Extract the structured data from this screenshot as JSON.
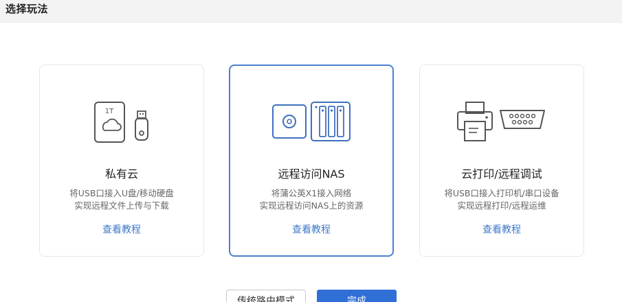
{
  "header": {
    "title": "选择玩法"
  },
  "cards": [
    {
      "title": "私有云",
      "desc_line1": "将USB口接入U盘/移动硬盘",
      "desc_line2": "实现远程文件上传与下载",
      "link": "查看教程",
      "icon": "cloud-storage-usb-icon",
      "icon_label": "1T",
      "selected": false
    },
    {
      "title": "远程访问NAS",
      "desc_line1": "将蒲公英X1接入网络",
      "desc_line2": "实现远程访问NAS上的资源",
      "link": "查看教程",
      "icon": "nas-icon",
      "selected": true
    },
    {
      "title": "云打印/远程调试",
      "desc_line1": "将USB口接入打印机/串口设备",
      "desc_line2": "实现远程打印/远程运维",
      "link": "查看教程",
      "icon": "printer-serial-icon",
      "selected": false
    }
  ],
  "buttons": {
    "secondary": "传统路由模式",
    "primary": "完成"
  },
  "colors": {
    "accent": "#2f6fd6",
    "selected_border": "#4a7fd0",
    "link": "#3f78c8"
  }
}
